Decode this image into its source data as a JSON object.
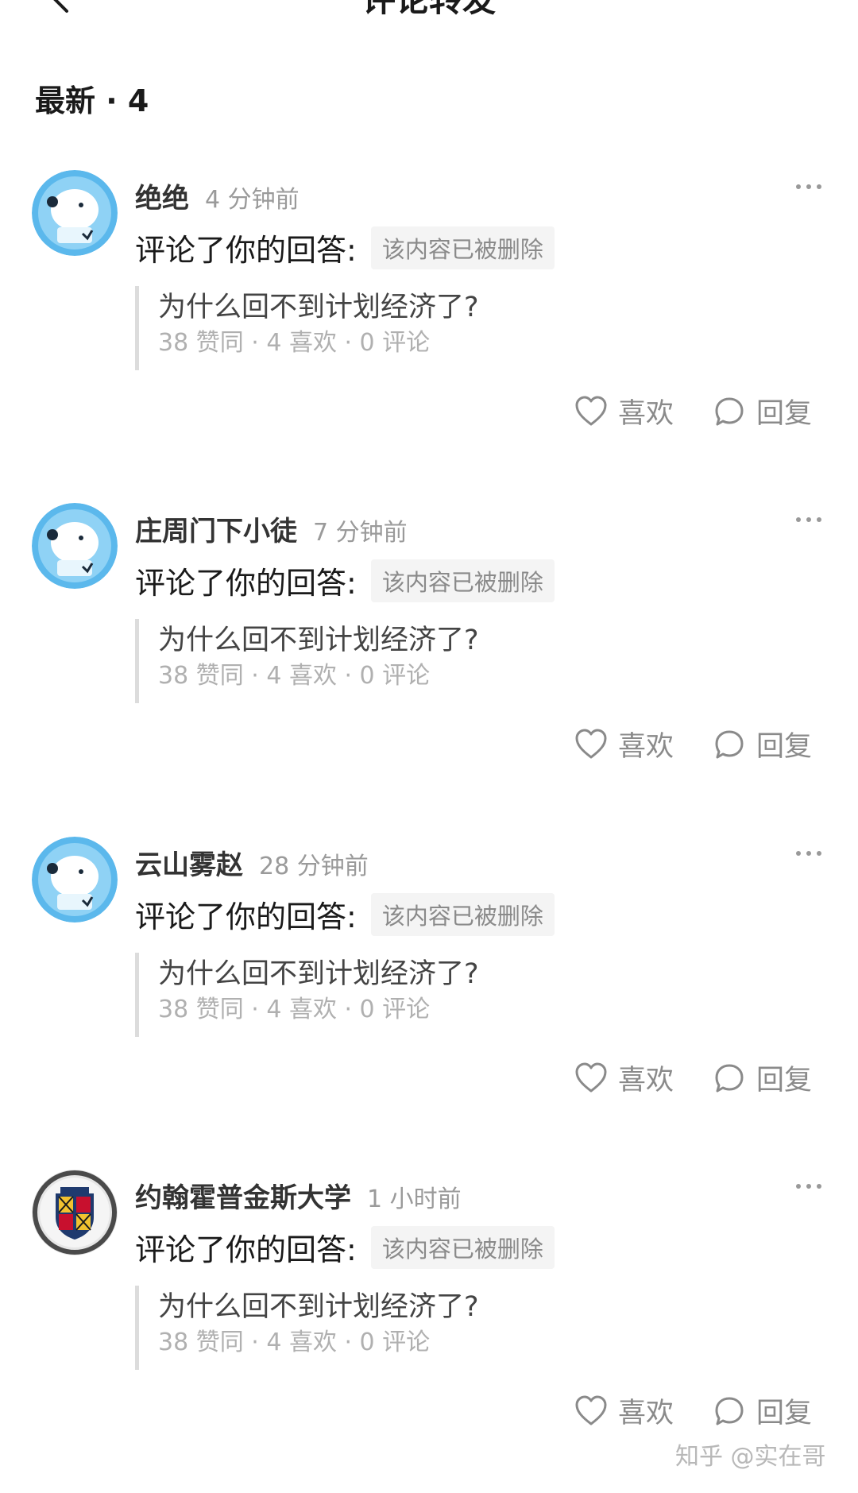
{
  "header": {
    "title": "评论转发"
  },
  "section": {
    "label": "最新 · 4"
  },
  "actions": {
    "like_label": "喜欢",
    "reply_label": "回复"
  },
  "items": [
    {
      "username": "绝绝",
      "time": "4 分钟前",
      "action_text": "评论了你的回答:",
      "deleted_tag": "该内容已被删除",
      "quote_title": "为什么回不到计划经济了?",
      "quote_stats": "38 赞同 · 4 喜欢 · 0 评论"
    },
    {
      "username": "庄周门下小徒",
      "time": "7 分钟前",
      "action_text": "评论了你的回答:",
      "deleted_tag": "该内容已被删除",
      "quote_title": "为什么回不到计划经济了?",
      "quote_stats": "38 赞同 · 4 喜欢 · 0 评论"
    },
    {
      "username": "云山雾赵",
      "time": "28 分钟前",
      "action_text": "评论了你的回答:",
      "deleted_tag": "该内容已被删除",
      "quote_title": "为什么回不到计划经济了?",
      "quote_stats": "38 赞同 · 4 喜欢 · 0 评论"
    },
    {
      "username": "约翰霍普金斯大学",
      "time": "1 小时前",
      "action_text": "评论了你的回答:",
      "deleted_tag": "该内容已被删除",
      "quote_title": "为什么回不到计划经济了?",
      "quote_stats": "38 赞同 · 4 喜欢 · 0 评论"
    }
  ],
  "watermark": "知乎 @实在哥",
  "colors": {
    "text": "#1a1a1a",
    "muted": "#9a9a9a",
    "tag_bg": "#f4f4f4",
    "avatar_blue": "#5bb8ec"
  }
}
